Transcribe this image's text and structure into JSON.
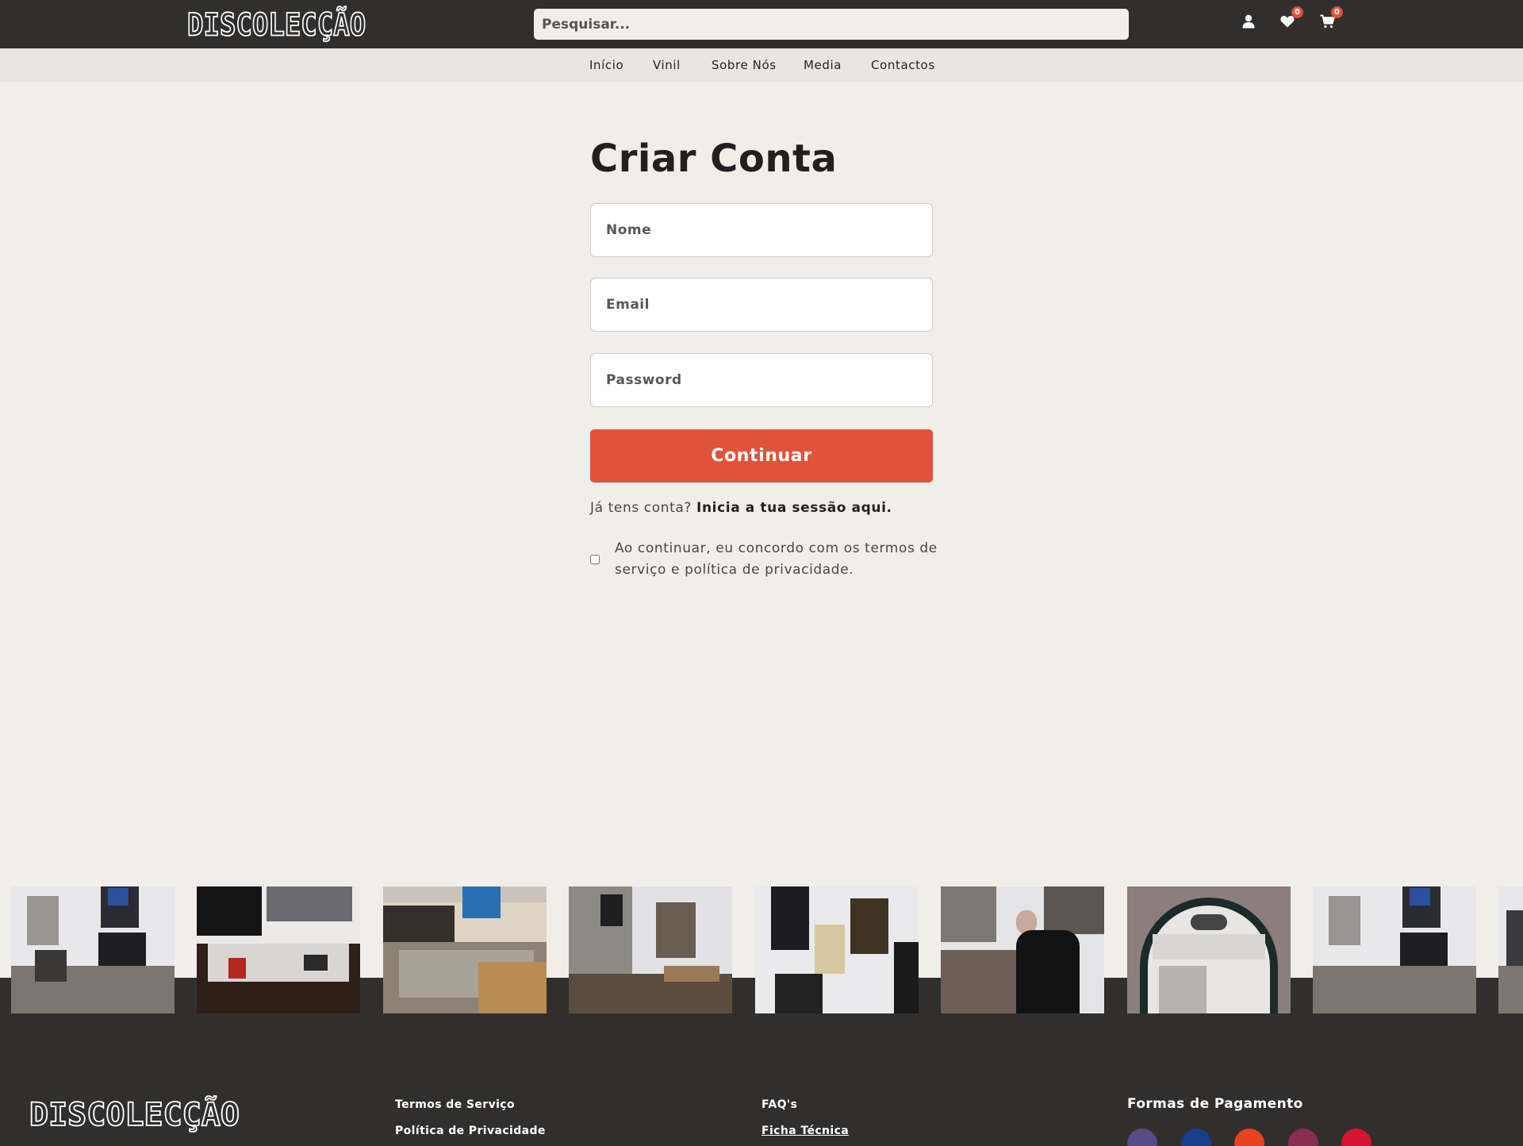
{
  "header": {
    "logo": "DISCOLECÇÃO",
    "search_placeholder": "Pesquisar...",
    "wishlist_count": "0",
    "cart_count": "0"
  },
  "nav": [
    "Início",
    "Vinil",
    "Sobre Nós",
    "Media",
    "Contactos"
  ],
  "form": {
    "title": "Criar Conta",
    "name_placeholder": "Nome",
    "email_placeholder": "Email",
    "password_placeholder": "Password",
    "submit_label": "Continuar",
    "login_prompt": "Já tens conta?",
    "login_link": "Inicia a tua sessão aqui.",
    "terms_text": "Ao continuar, eu concordo com os termos de serviço e política de privacidade."
  },
  "footer": {
    "logo": "DISCOLECÇÃO",
    "links_col1": [
      "Termos de Serviço",
      "Política de Privacidade"
    ],
    "links_col2": [
      "FAQ's",
      "Ficha Técnica"
    ],
    "payments_heading": "Formas de Pagamento",
    "payment_methods": [
      {
        "icon": "visa-icon",
        "color": "#5a4a8a"
      },
      {
        "icon": "paypal-icon",
        "color": "#1a3e8c"
      },
      {
        "icon": "multibanco-icon",
        "color": "#e8431f"
      },
      {
        "icon": "mastercard-icon",
        "color": "#8a2d52"
      },
      {
        "icon": "mbway-icon",
        "color": "#d8152e"
      }
    ]
  },
  "colors": {
    "accent": "#e0523a",
    "dark": "#302f2e",
    "background": "#f1eeea"
  }
}
